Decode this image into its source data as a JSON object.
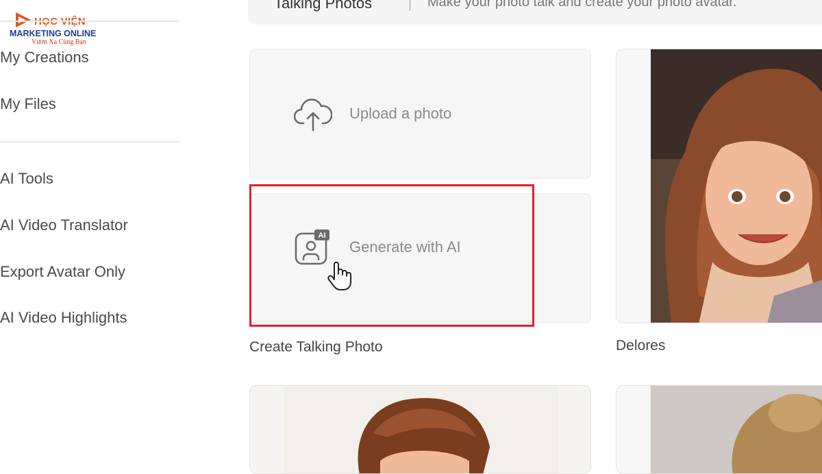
{
  "logo": {
    "line1": "HỌC VIỆN",
    "line2": "MARKETING ONLINE",
    "line3": "Vươn Xa Cùng Bạn"
  },
  "sidebar": {
    "items": [
      {
        "label": "My Creations"
      },
      {
        "label": "My Files"
      },
      {
        "label": "AI Tools"
      },
      {
        "label": "AI Video Translator"
      },
      {
        "label": "Export Avatar Only"
      },
      {
        "label": "AI Video Highlights"
      }
    ]
  },
  "header": {
    "title": "Talking Photos",
    "subtitle": "Make your photo talk and create your photo avatar."
  },
  "main": {
    "upload_label": "Upload a photo",
    "generate_label": "Generate with AI",
    "generate_badge": "AI",
    "create_caption": "Create Talking Photo",
    "avatars": [
      {
        "name": "Delores"
      }
    ]
  },
  "icons": {
    "upload": "cloud-upload-icon",
    "generate": "ai-portrait-icon",
    "cursor": "hand-pointer-icon",
    "logo": "play-icon"
  },
  "colors": {
    "highlight": "#e0202a",
    "logo_orange": "#e05a1e",
    "logo_blue": "#1f3f95",
    "logo_red": "#d23222"
  }
}
